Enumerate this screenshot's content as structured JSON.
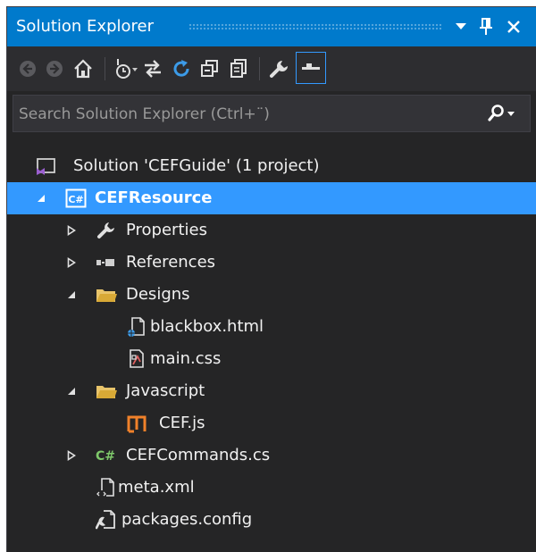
{
  "window": {
    "title": "Solution Explorer",
    "accent_color": "#007acc",
    "title_buttons": [
      {
        "name": "dropdown-arrow-icon"
      },
      {
        "name": "pin-icon"
      },
      {
        "name": "close-icon"
      }
    ]
  },
  "toolbar": {
    "buttons": [
      {
        "name": "back-icon",
        "enabled": false
      },
      {
        "name": "forward-icon",
        "enabled": false
      },
      {
        "name": "home-icon",
        "enabled": true
      },
      {
        "name": "pending-changes-filter-icon",
        "enabled": true
      },
      {
        "name": "sync-with-active-document-icon",
        "enabled": true
      },
      {
        "name": "refresh-icon",
        "enabled": true
      },
      {
        "name": "collapse-all-icon",
        "enabled": true
      },
      {
        "name": "show-all-files-icon",
        "enabled": true
      },
      {
        "name": "properties-icon",
        "enabled": true
      },
      {
        "name": "preview-selected-items-icon",
        "enabled": true,
        "active": true
      }
    ]
  },
  "search": {
    "placeholder": "Search Solution Explorer (Ctrl+¨)",
    "value": ""
  },
  "tree": [
    {
      "label": "Solution 'CEFGuide' (1 project)",
      "icon": "solution-icon",
      "expander": "none",
      "selected": false
    },
    {
      "label": "CEFResource",
      "icon": "csharp-project-icon",
      "expander": "expanded",
      "selected": true
    },
    {
      "label": "Properties",
      "icon": "wrench-icon",
      "expander": "collapsed",
      "selected": false
    },
    {
      "label": "References",
      "icon": "references-icon",
      "expander": "collapsed",
      "selected": false
    },
    {
      "label": "Designs",
      "icon": "folder-open-icon",
      "expander": "expanded",
      "selected": false
    },
    {
      "label": "blackbox.html",
      "icon": "html-file-icon",
      "expander": "none",
      "selected": false
    },
    {
      "label": "main.css",
      "icon": "css-file-icon",
      "expander": "none",
      "selected": false
    },
    {
      "label": "Javascript",
      "icon": "folder-open-icon",
      "expander": "expanded",
      "selected": false
    },
    {
      "label": "CEF.js",
      "icon": "js-file-icon",
      "expander": "none",
      "selected": false
    },
    {
      "label": "CEFCommands.cs",
      "icon": "csharp-file-icon",
      "expander": "collapsed",
      "selected": false
    },
    {
      "label": "meta.xml",
      "icon": "xml-file-icon",
      "expander": "none",
      "selected": false
    },
    {
      "label": "packages.config",
      "icon": "config-file-icon",
      "expander": "none",
      "selected": false
    }
  ]
}
